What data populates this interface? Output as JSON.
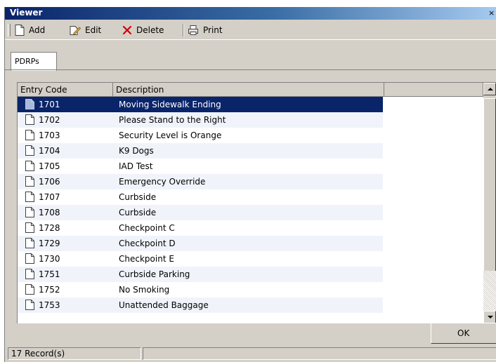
{
  "window": {
    "title": "Viewer",
    "close_glyph": "×"
  },
  "toolbar": {
    "add_label": "Add",
    "add_icon": "new-document-icon",
    "edit_label": "Edit",
    "edit_icon": "edit-document-icon",
    "delete_label": "Delete",
    "delete_icon": "red-x-delete-icon",
    "print_label": "Print",
    "print_icon": "printer-icon"
  },
  "tabs": [
    {
      "label": "PDRPs",
      "active": true
    }
  ],
  "grid": {
    "columns": [
      "Entry Code",
      "Description",
      ""
    ],
    "selected_index": 0,
    "rows": [
      {
        "code": "1701",
        "description": "Moving Sidewalk Ending"
      },
      {
        "code": "1702",
        "description": "Please Stand to the Right"
      },
      {
        "code": "1703",
        "description": "Security Level is Orange"
      },
      {
        "code": "1704",
        "description": "K9 Dogs"
      },
      {
        "code": "1705",
        "description": "IAD Test"
      },
      {
        "code": "1706",
        "description": "Emergency Override"
      },
      {
        "code": "1707",
        "description": "Curbside"
      },
      {
        "code": "1708",
        "description": "Curbside"
      },
      {
        "code": "1728",
        "description": "Checkpoint C"
      },
      {
        "code": "1729",
        "description": "Checkpoint D"
      },
      {
        "code": "1730",
        "description": "Checkpoint E"
      },
      {
        "code": "1751",
        "description": "Curbside Parking"
      },
      {
        "code": "1752",
        "description": "No Smoking"
      },
      {
        "code": "1753",
        "description": "Unattended Baggage"
      }
    ]
  },
  "buttons": {
    "ok_label": "OK"
  },
  "status": {
    "records": "17 Record(s)",
    "panel2": ""
  },
  "colors": {
    "selection": "#0a246a",
    "face": "#d4d0c8",
    "delete_red": "#d40000"
  }
}
